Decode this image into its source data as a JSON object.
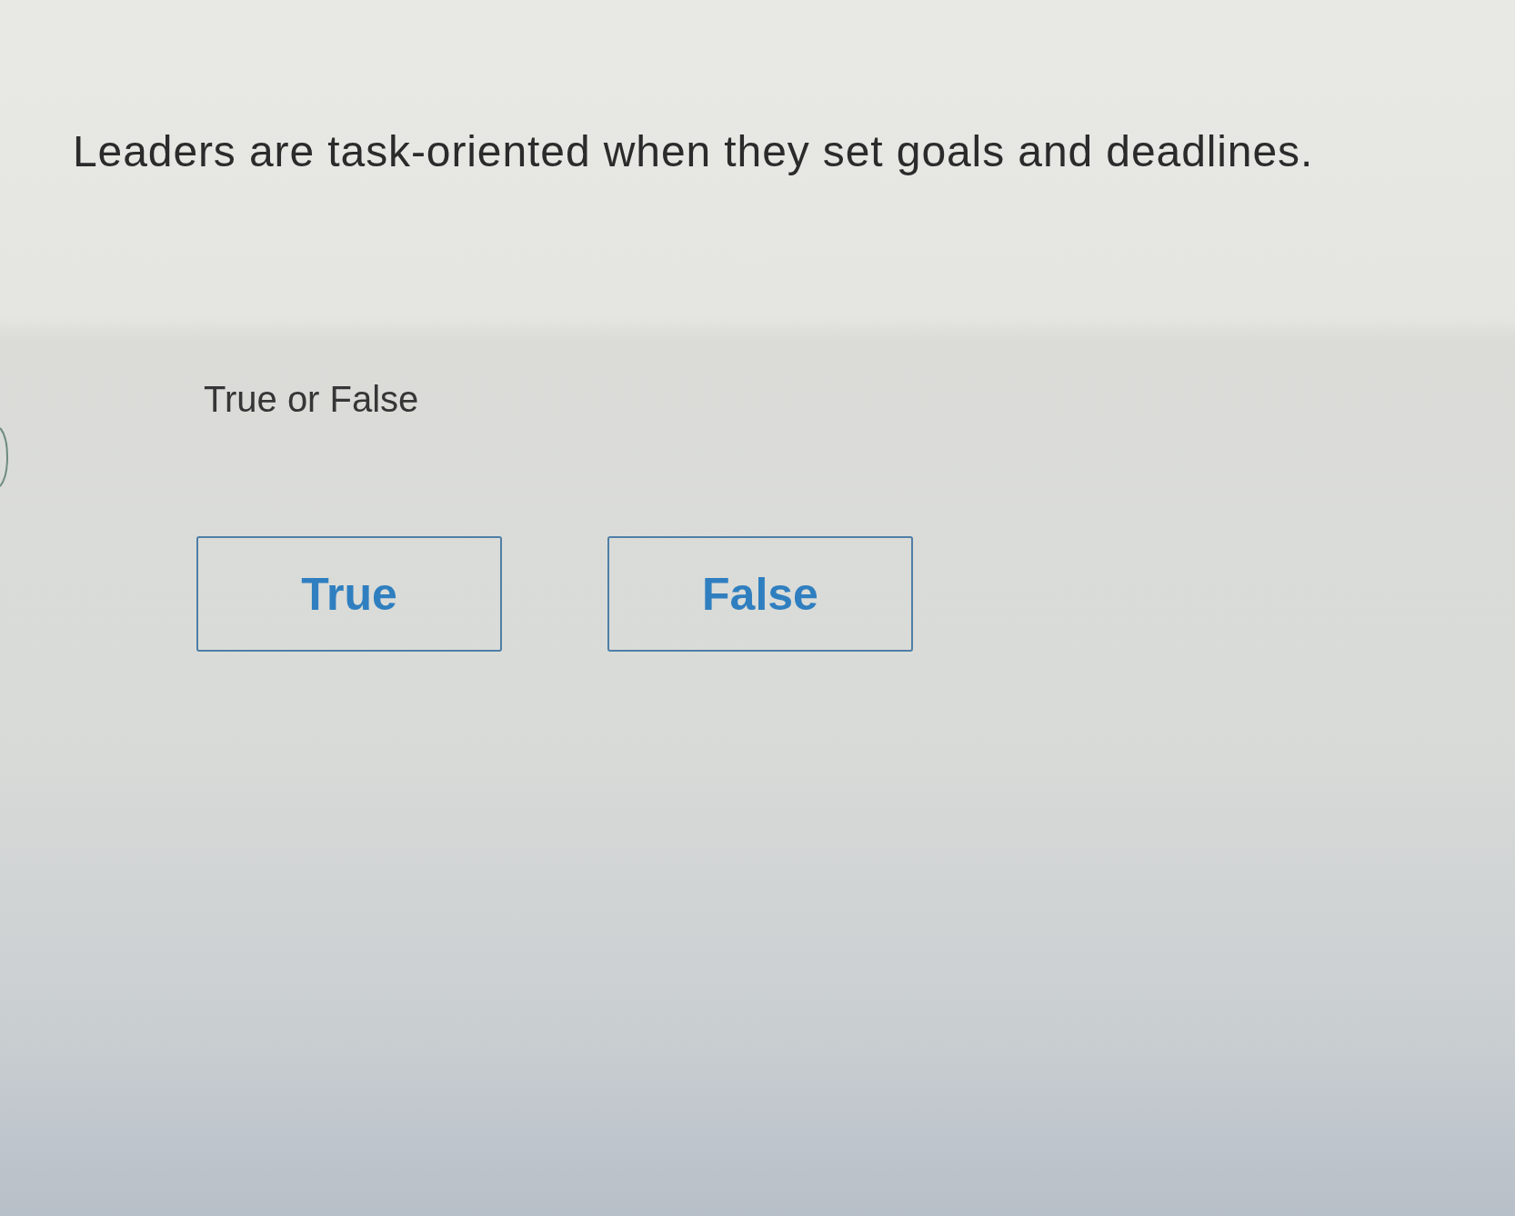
{
  "question": {
    "text": "Leaders are task-oriented when they set goals and deadlines."
  },
  "prompt": "True or False",
  "options": [
    {
      "label": "True"
    },
    {
      "label": "False"
    }
  ]
}
